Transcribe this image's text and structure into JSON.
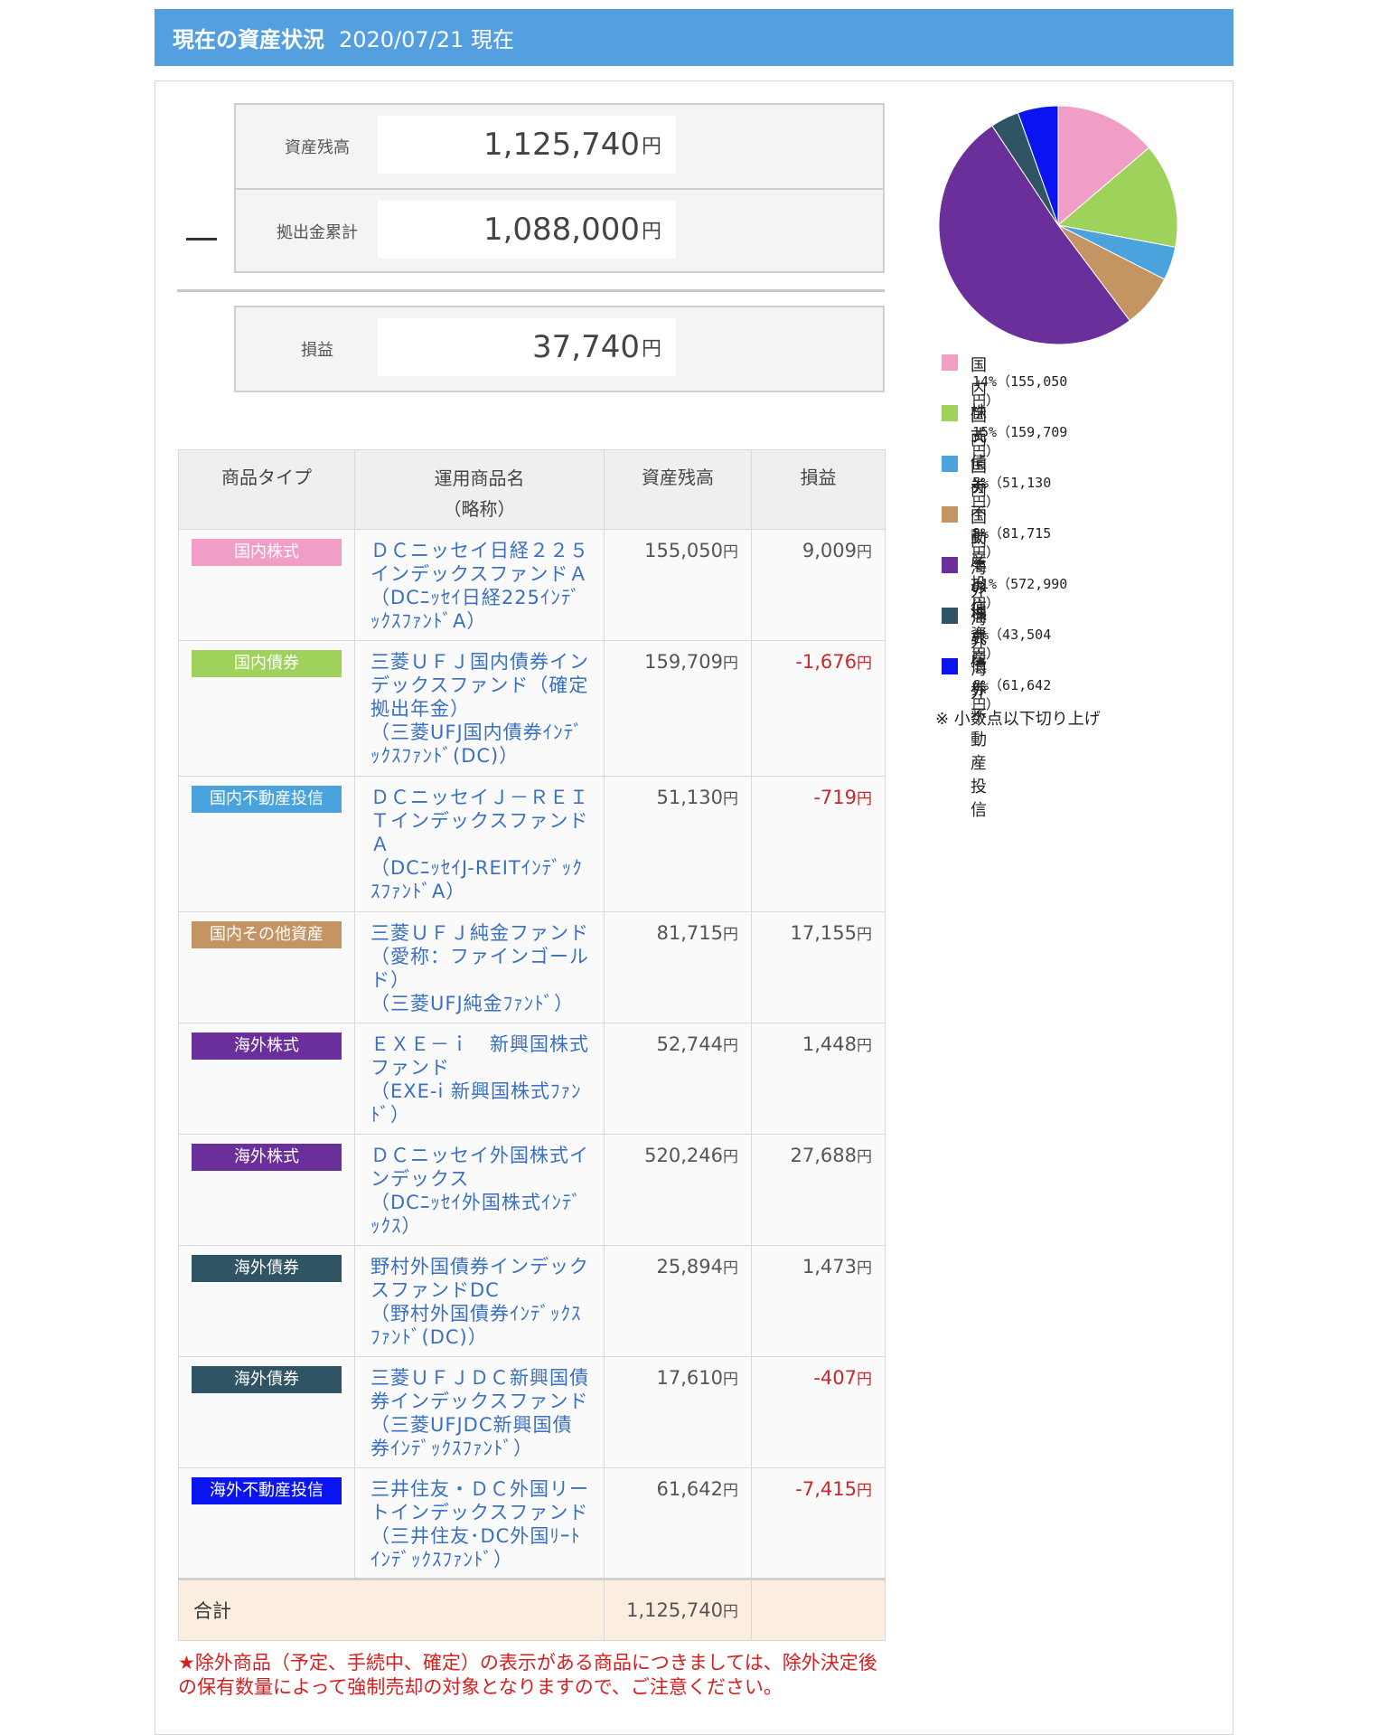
{
  "header": {
    "title": "現在の資産状況",
    "date": "2020/07/21 現在"
  },
  "summary": {
    "balance_label": "資産残高",
    "balance_value": "1,125,740",
    "contrib_label": "拠出金累計",
    "contrib_value": "1,088,000",
    "profit_label": "損益",
    "profit_value": "37,740",
    "yen": "円"
  },
  "table": {
    "headers": {
      "type": "商品タイプ",
      "name": "運用商品名",
      "name_sub": "（略称）",
      "balance": "資産残高",
      "profit": "損益"
    },
    "rows": [
      {
        "type": "国内株式",
        "color": "#f19ec6",
        "name": "ＤＣニッセイ日経２２５インデックスファンドＡ",
        "abbr": "（DCﾆｯｾｲ日経225ｲﾝﾃﾞｯｸｽﾌｧﾝﾄﾞA）",
        "balance": "155,050",
        "profit": "9,009",
        "neg": false
      },
      {
        "type": "国内債券",
        "color": "#9fd25a",
        "name": "三菱ＵＦＪ国内債券インデックスファンド（確定拠出年金）",
        "abbr": "（三菱UFJ国内債券ｲﾝﾃﾞｯｸｽﾌｧﾝﾄﾞ(DC)）",
        "balance": "159,709",
        "profit": "-1,676",
        "neg": true
      },
      {
        "type": "国内不動産投信",
        "color": "#4aa3dc",
        "name": "ＤＣニッセイＪ－ＲＥＩＴインデックスファンドＡ",
        "abbr": "（DCﾆｯｾｲJ-REITｲﾝﾃﾞｯｸｽﾌｧﾝﾄﾞA）",
        "balance": "51,130",
        "profit": "-719",
        "neg": true
      },
      {
        "type": "国内その他資産",
        "color": "#c49463",
        "name": "三菱ＵＦＪ純金ファンド（愛称：ファインゴールド）",
        "abbr": "（三菱UFJ純金ﾌｧﾝﾄﾞ）",
        "balance": "81,715",
        "profit": "17,155",
        "neg": false
      },
      {
        "type": "海外株式",
        "color": "#6a2f9a",
        "name": "ＥＸＥ－ｉ　新興国株式ファンド",
        "abbr": "（EXE-i 新興国株式ﾌｧﾝﾄﾞ）",
        "balance": "52,744",
        "profit": "1,448",
        "neg": false
      },
      {
        "type": "海外株式",
        "color": "#6a2f9a",
        "name": "ＤＣニッセイ外国株式インデックス",
        "abbr": "（DCﾆｯｾｲ外国株式ｲﾝﾃﾞｯｸｽ）",
        "balance": "520,246",
        "profit": "27,688",
        "neg": false
      },
      {
        "type": "海外債券",
        "color": "#2f5564",
        "name": "野村外国債券インデックスファンドDC",
        "abbr": "（野村外国債券ｲﾝﾃﾞｯｸｽﾌｧﾝﾄﾞ(DC)）",
        "balance": "25,894",
        "profit": "1,473",
        "neg": false
      },
      {
        "type": "海外債券",
        "color": "#2f5564",
        "name": "三菱ＵＦＪＤＣ新興国債券インデックスファンド",
        "abbr": "（三菱UFJDC新興国債券ｲﾝﾃﾞｯｸｽﾌｧﾝﾄﾞ）",
        "balance": "17,610",
        "profit": "-407",
        "neg": true
      },
      {
        "type": "海外不動産投信",
        "color": "#0a14f0",
        "name": "三井住友・ＤＣ外国リートインデックスファンド",
        "abbr": "（三井住友･DC外国ﾘｰﾄｲﾝﾃﾞｯｸｽﾌｧﾝﾄﾞ）",
        "balance": "61,642",
        "profit": "-7,415",
        "neg": true
      }
    ],
    "total_label": "合計",
    "total_value": "1,125,740",
    "yen": "円"
  },
  "note": "★除外商品（予定、手続中、確定）の表示がある商品につきましては、除外決定後の保有数量によって強制売却の対象となりますので、ご注意ください。",
  "chart_data": {
    "type": "pie",
    "labels": [
      "国内株式",
      "国内債券",
      "国内不動産投信",
      "国内その他資産",
      "海外株式",
      "海外債券",
      "海外不動産投信"
    ],
    "values": [
      155050,
      159709,
      51130,
      81715,
      572990,
      43504,
      61642
    ],
    "colors": [
      "#f19ec6",
      "#9fd25a",
      "#4aa3dc",
      "#c49463",
      "#6a2f9a",
      "#2f5564",
      "#0a14f0"
    ],
    "legend_pct": [
      "14%（155,050円）",
      "15%（159,709円）",
      "5%（51,130円）",
      "8%（81,715円）",
      "51%（572,990円）",
      "4%（43,504円）",
      "6%（61,642円）"
    ],
    "legend_position": "bottom",
    "note": "※ 小数点以下切り上げ"
  }
}
